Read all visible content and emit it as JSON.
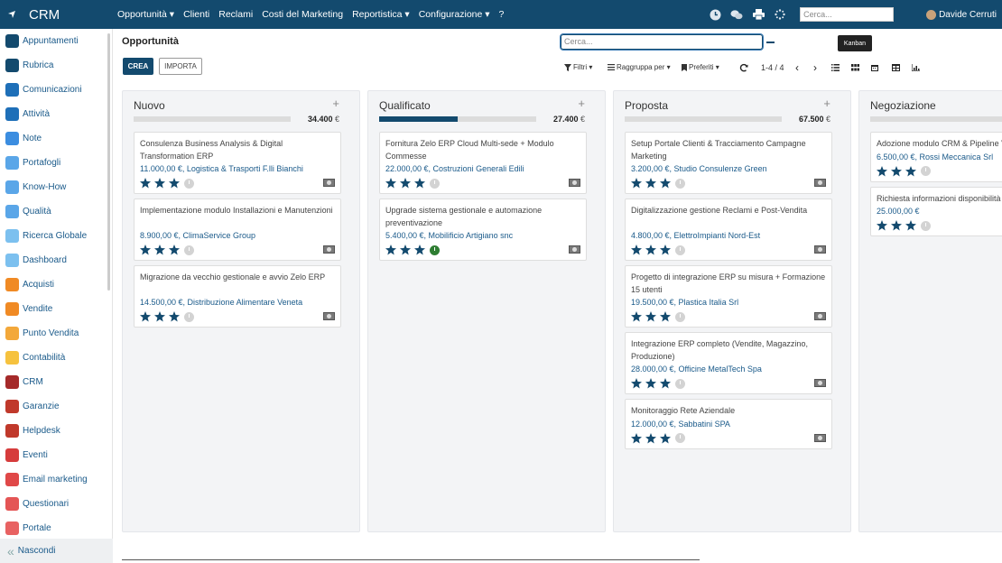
{
  "app": {
    "title": "CRM"
  },
  "menu": [
    "Opportunità ▾",
    "Clienti",
    "Reclami",
    "Costi del Marketing",
    "Reportistica ▾",
    "Configurazione ▾",
    "?"
  ],
  "topbar": {
    "search_placeholder": "Cerca...",
    "user": "Davide Cerruti"
  },
  "sidebar": {
    "items": [
      {
        "label": "Appuntamenti",
        "color": "#134a6e",
        "icon": "calendar-icon"
      },
      {
        "label": "Rubrica",
        "color": "#134a6e",
        "icon": "contacts-icon"
      },
      {
        "label": "Comunicazioni",
        "color": "#1e6fb8",
        "icon": "chat-icon"
      },
      {
        "label": "Attività",
        "color": "#1e6fb8",
        "icon": "check-icon"
      },
      {
        "label": "Note",
        "color": "#3b8de0",
        "icon": "note-icon"
      },
      {
        "label": "Portafogli",
        "color": "#5aa6e8",
        "icon": "wallet-icon"
      },
      {
        "label": "Know-How",
        "color": "#5aa6e8",
        "icon": "bulb-icon"
      },
      {
        "label": "Qualità",
        "color": "#5aa6e8",
        "icon": "quality-icon"
      },
      {
        "label": "Ricerca Globale",
        "color": "#7cc0ef",
        "icon": "search-icon"
      },
      {
        "label": "Dashboard",
        "color": "#7cc0ef",
        "icon": "dashboard-icon"
      },
      {
        "label": "Acquisti",
        "color": "#f08a24",
        "icon": "cart-icon"
      },
      {
        "label": "Vendite",
        "color": "#f08a24",
        "icon": "chart-icon"
      },
      {
        "label": "Punto Vendita",
        "color": "#f3a83a",
        "icon": "pos-icon"
      },
      {
        "label": "Contabilità",
        "color": "#f6c23e",
        "icon": "accounting-icon"
      },
      {
        "label": "CRM",
        "color": "#a52a2a",
        "icon": "crm-icon"
      },
      {
        "label": "Garanzie",
        "color": "#c0392b",
        "icon": "shield-icon"
      },
      {
        "label": "Helpdesk",
        "color": "#c0392b",
        "icon": "headset-icon"
      },
      {
        "label": "Eventi",
        "color": "#d63c3c",
        "icon": "event-icon"
      },
      {
        "label": "Email marketing",
        "color": "#e04848",
        "icon": "email-icon"
      },
      {
        "label": "Questionari",
        "color": "#e45555",
        "icon": "survey-icon"
      },
      {
        "label": "Portale",
        "color": "#e86262",
        "icon": "portal-icon"
      }
    ],
    "footer": "Nascondi"
  },
  "control_panel": {
    "title": "Opportunità",
    "create_label": "CREA",
    "import_label": "IMPORTA",
    "search_placeholder": "Cerca...",
    "filters_label": "Filtri ▾",
    "groupby_label": "Raggruppa per ▾",
    "favorites_label": "Preferiti ▾",
    "pager": "1-4 / 4",
    "tooltip": "Kanban"
  },
  "columns": [
    {
      "title": "Nuovo",
      "total": "34.400",
      "currency": "€",
      "progress": 0,
      "cards": [
        {
          "name": "Consulenza Business Analysis & Digital Transformation ERP",
          "revenue": "11.000,00 €, Logistica & Trasporti F.lli Bianchi",
          "stars": 3,
          "activity": "none"
        },
        {
          "name": "Implementazione modulo Installazioni e Manutenzioni",
          "revenue": "8.900,00 €, ClimaService Group",
          "stars": 3,
          "activity": "none"
        },
        {
          "name": "Migrazione da vecchio gestionale e avvio Zelo ERP",
          "revenue": "14.500,00 €, Distribuzione Alimentare Veneta",
          "stars": 3,
          "activity": "none"
        }
      ]
    },
    {
      "title": "Qualificato",
      "total": "27.400",
      "currency": "€",
      "progress": 0.5,
      "cards": [
        {
          "name": "Fornitura Zelo ERP Cloud Multi-sede + Modulo Commesse",
          "revenue": "22.000,00 €, Costruzioni Generali Edili",
          "stars": 3,
          "activity": "none"
        },
        {
          "name": "Upgrade sistema gestionale e automazione preventivazione",
          "revenue": "5.400,00 €, Mobilificio Artigiano snc",
          "stars": 3,
          "activity": "planned"
        }
      ]
    },
    {
      "title": "Proposta",
      "total": "67.500",
      "currency": "€",
      "progress": 0,
      "cards": [
        {
          "name": "Setup Portale Clienti & Tracciamento Campagne Marketing",
          "revenue": "3.200,00 €, Studio Consulenze Green",
          "stars": 3,
          "activity": "none"
        },
        {
          "name": "Digitalizzazione gestione Reclami e Post-Vendita",
          "revenue": "4.800,00 €, ElettroImpianti Nord-Est",
          "stars": 3,
          "activity": "none"
        },
        {
          "name": "Progetto di integrazione ERP su misura + Formazione 15 utenti",
          "revenue": "19.500,00 €, Plastica Italia Srl",
          "stars": 3,
          "activity": "none"
        },
        {
          "name": "Integrazione ERP completo (Vendite, Magazzino, Produzione)",
          "revenue": "28.000,00 €, Officine MetalTech Spa",
          "stars": 3,
          "activity": "none"
        },
        {
          "name": "Monitoraggio Rete Aziendale",
          "revenue": "12.000,00 €, Sabbatini SPA",
          "stars": 3,
          "activity": "none"
        }
      ]
    },
    {
      "title": "Negoziazione",
      "total": "",
      "currency": "",
      "progress": 0,
      "cards": [
        {
          "name": "Adozione modulo CRM & Pipeline V",
          "revenue": "6.500,00 €, Rossi Meccanica Srl",
          "stars": 3,
          "activity": "none"
        },
        {
          "name": "Richiesta informazioni disponibilità",
          "revenue": "25.000,00 €",
          "stars": 3,
          "activity": "none"
        }
      ]
    }
  ]
}
